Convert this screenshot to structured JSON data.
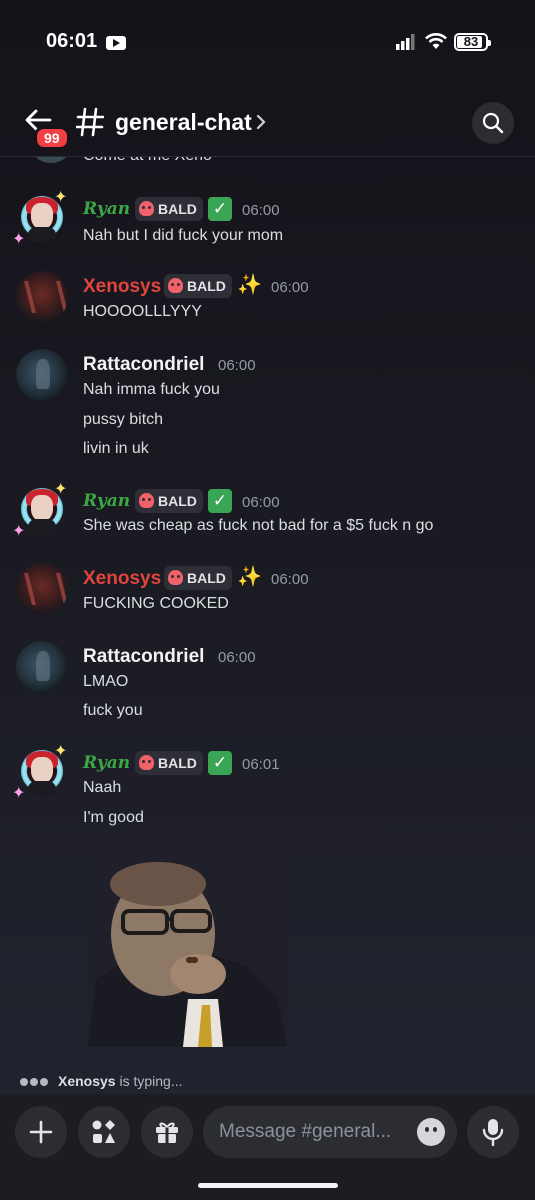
{
  "status_bar": {
    "time": "06:01",
    "battery": "83"
  },
  "header": {
    "back_badge": "99",
    "channel_name": "general-chat"
  },
  "chat": {
    "cut_message": "Come at me Xeno",
    "messages": [
      {
        "author": "Ryan",
        "role": "BALD",
        "time": "06:00",
        "lines": [
          "Nah but I did fuck your mom"
        ]
      },
      {
        "author": "Xenosys",
        "role": "BALD",
        "time": "06:00",
        "lines": [
          "HOOOOLLLYYY"
        ]
      },
      {
        "author": "Rattacondriel",
        "time": "06:00",
        "lines": [
          "Nah imma fuck you",
          "pussy bitch",
          "livin in uk"
        ]
      },
      {
        "author": "Ryan",
        "role": "BALD",
        "time": "06:00",
        "lines": [
          "She was cheap as fuck not bad for a $5 fuck n go"
        ]
      },
      {
        "author": "Xenosys",
        "role": "BALD",
        "time": "06:00",
        "lines": [
          "FUCKING COOKED"
        ]
      },
      {
        "author": "Rattacondriel",
        "time": "06:00",
        "lines": [
          "LMAO",
          "fuck you"
        ]
      },
      {
        "author": "Ryan",
        "role": "BALD",
        "time": "06:01",
        "lines": [
          "Naah",
          "I'm good"
        ]
      }
    ]
  },
  "typing": {
    "user": "Xenosys",
    "text": "is typing..."
  },
  "composer": {
    "placeholder": "Message #general..."
  },
  "colors": {
    "ryan": "#3ba745",
    "xenosys": "#e0453e",
    "badge": "#f23f43"
  }
}
